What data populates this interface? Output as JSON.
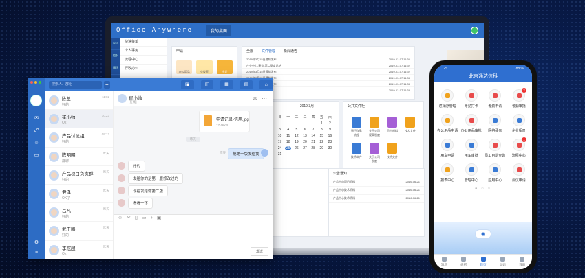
{
  "laptop": {
    "brand": "Office Anywhere",
    "tab": "我的桌面",
    "side": [
      "SNS",
      "组织",
      "通讯"
    ],
    "nav": [
      "快速菜单",
      "个人事务",
      "流程中心",
      "行政办公"
    ],
    "apps_title": "申请",
    "apps": [
      "办公用品",
      "会议室",
      "出差",
      "",
      "",
      ""
    ],
    "news_tabs": [
      "全部",
      "文件管理",
      "新闻通告"
    ],
    "news": [
      {
        "t": "2019年3月15日通知发布",
        "d": "2019-03-07 11:30"
      },
      {
        "t": "产业中心-建议-第二季度总结",
        "d": "2019-03-07 11:32"
      },
      {
        "t": "2019年3月15日通知发布",
        "d": "2019-03-07 11:32"
      },
      {
        "t": "2019年3月15日通知发布",
        "d": "2019-03-07 11:33"
      },
      {
        "t": "2019年3月15日通知发布",
        "d": "2019-03-07 11:33"
      },
      {
        "t": "产业中心-建议",
        "d": "2019-03-07 11:33"
      }
    ],
    "cal_title": "2019 3月",
    "week": [
      "日",
      "一",
      "二",
      "三",
      "四",
      "五",
      "六"
    ],
    "days": [
      "",
      "",
      "",
      "",
      "",
      "1",
      "2",
      "3",
      "4",
      "5",
      "6",
      "7",
      "8",
      "9",
      "10",
      "11",
      "12",
      "13",
      "14",
      "15",
      "16",
      "17",
      "18",
      "19",
      "20",
      "21",
      "22",
      "23",
      "24",
      "25",
      "26",
      "27",
      "28",
      "29",
      "30",
      "31",
      "",
      "",
      "",
      "",
      "",
      ""
    ],
    "docs_title": "公共文件柜",
    "docs": [
      "银行存款流程",
      "关于公司规章制度",
      "员人材料",
      "技术文件",
      "技术文件",
      "关于公司制度",
      "技术文件"
    ],
    "notice_title": "公告通知",
    "notices": [
      {
        "t": "产品中心项目资料",
        "d": "2016-06-21"
      },
      {
        "t": "产品中心技术资料",
        "d": "2016-06-21"
      },
      {
        "t": "产品中心技术资料",
        "d": "2016-06-21"
      }
    ]
  },
  "chat": {
    "search_placeholder": "搜索人、群组",
    "list": [
      {
        "n": "陈总",
        "p": "好的",
        "t": "11:02"
      },
      {
        "n": "崔小帅",
        "p": "Ok",
        "t": "10:23"
      },
      {
        "n": "产品讨论组",
        "p": "好的",
        "t": "09:12"
      },
      {
        "n": "陈明明",
        "p": "群聊",
        "t": "昨天"
      },
      {
        "n": "产品项目负责群",
        "p": "好的",
        "t": "昨天"
      },
      {
        "n": "尹泽",
        "p": "OK了",
        "t": "昨天"
      },
      {
        "n": "吕凡",
        "p": "好的",
        "t": "昨天"
      },
      {
        "n": "武王鹏",
        "p": "好的",
        "t": "昨天"
      },
      {
        "n": "李冠超",
        "p": "Ok",
        "t": "昨天"
      }
    ],
    "peer_name": "崔小帅",
    "peer_status": "[在线]",
    "file_name": "申请记录-信用.jpg",
    "file_size": "17.46KB",
    "time_tag": "昨天",
    "my_msg": "把第一版发给我",
    "msgs": [
      "好的",
      "发给你的是第一版修改过的",
      "现在发给你第二版",
      "看看一下"
    ],
    "send": "发送"
  },
  "phone": {
    "carrier": "GS",
    "battery": "88 %",
    "title": "北京通达信科",
    "icons": [
      {
        "l": "进销存管理",
        "c": "#f0a21c",
        "b": ""
      },
      {
        "l": "考勤打卡",
        "c": "#e84b4b",
        "b": ""
      },
      {
        "l": "考勤申请",
        "c": "#e84b4b",
        "b": ""
      },
      {
        "l": "考勤审批",
        "c": "#e84b4b",
        "b": "2"
      },
      {
        "l": "办公用品申请",
        "c": "#f0a21c",
        "b": ""
      },
      {
        "l": "办公用品审批",
        "c": "#e84b4b",
        "b": ""
      },
      {
        "l": "网络硬盘",
        "c": "#3a7bd5",
        "b": ""
      },
      {
        "l": "企业相册",
        "c": "#3a7bd5",
        "b": ""
      },
      {
        "l": "用车申请",
        "c": "#3a7bd5",
        "b": ""
      },
      {
        "l": "用车审批",
        "c": "#3a7bd5",
        "b": ""
      },
      {
        "l": "员工自助查询",
        "c": "#e84b4b",
        "b": ""
      },
      {
        "l": "流程中心",
        "c": "#e84b4b",
        "b": "1"
      },
      {
        "l": "报表中心",
        "c": "#f0a21c",
        "b": ""
      },
      {
        "l": "管理中心",
        "c": "#3a7bd5",
        "b": ""
      },
      {
        "l": "应用中心",
        "c": "#3a7bd5",
        "b": ""
      },
      {
        "l": "会议申请",
        "c": "#e84b4b",
        "b": ""
      }
    ],
    "tabs": [
      "消息",
      "组织",
      "首页",
      "动态",
      "我的"
    ]
  }
}
